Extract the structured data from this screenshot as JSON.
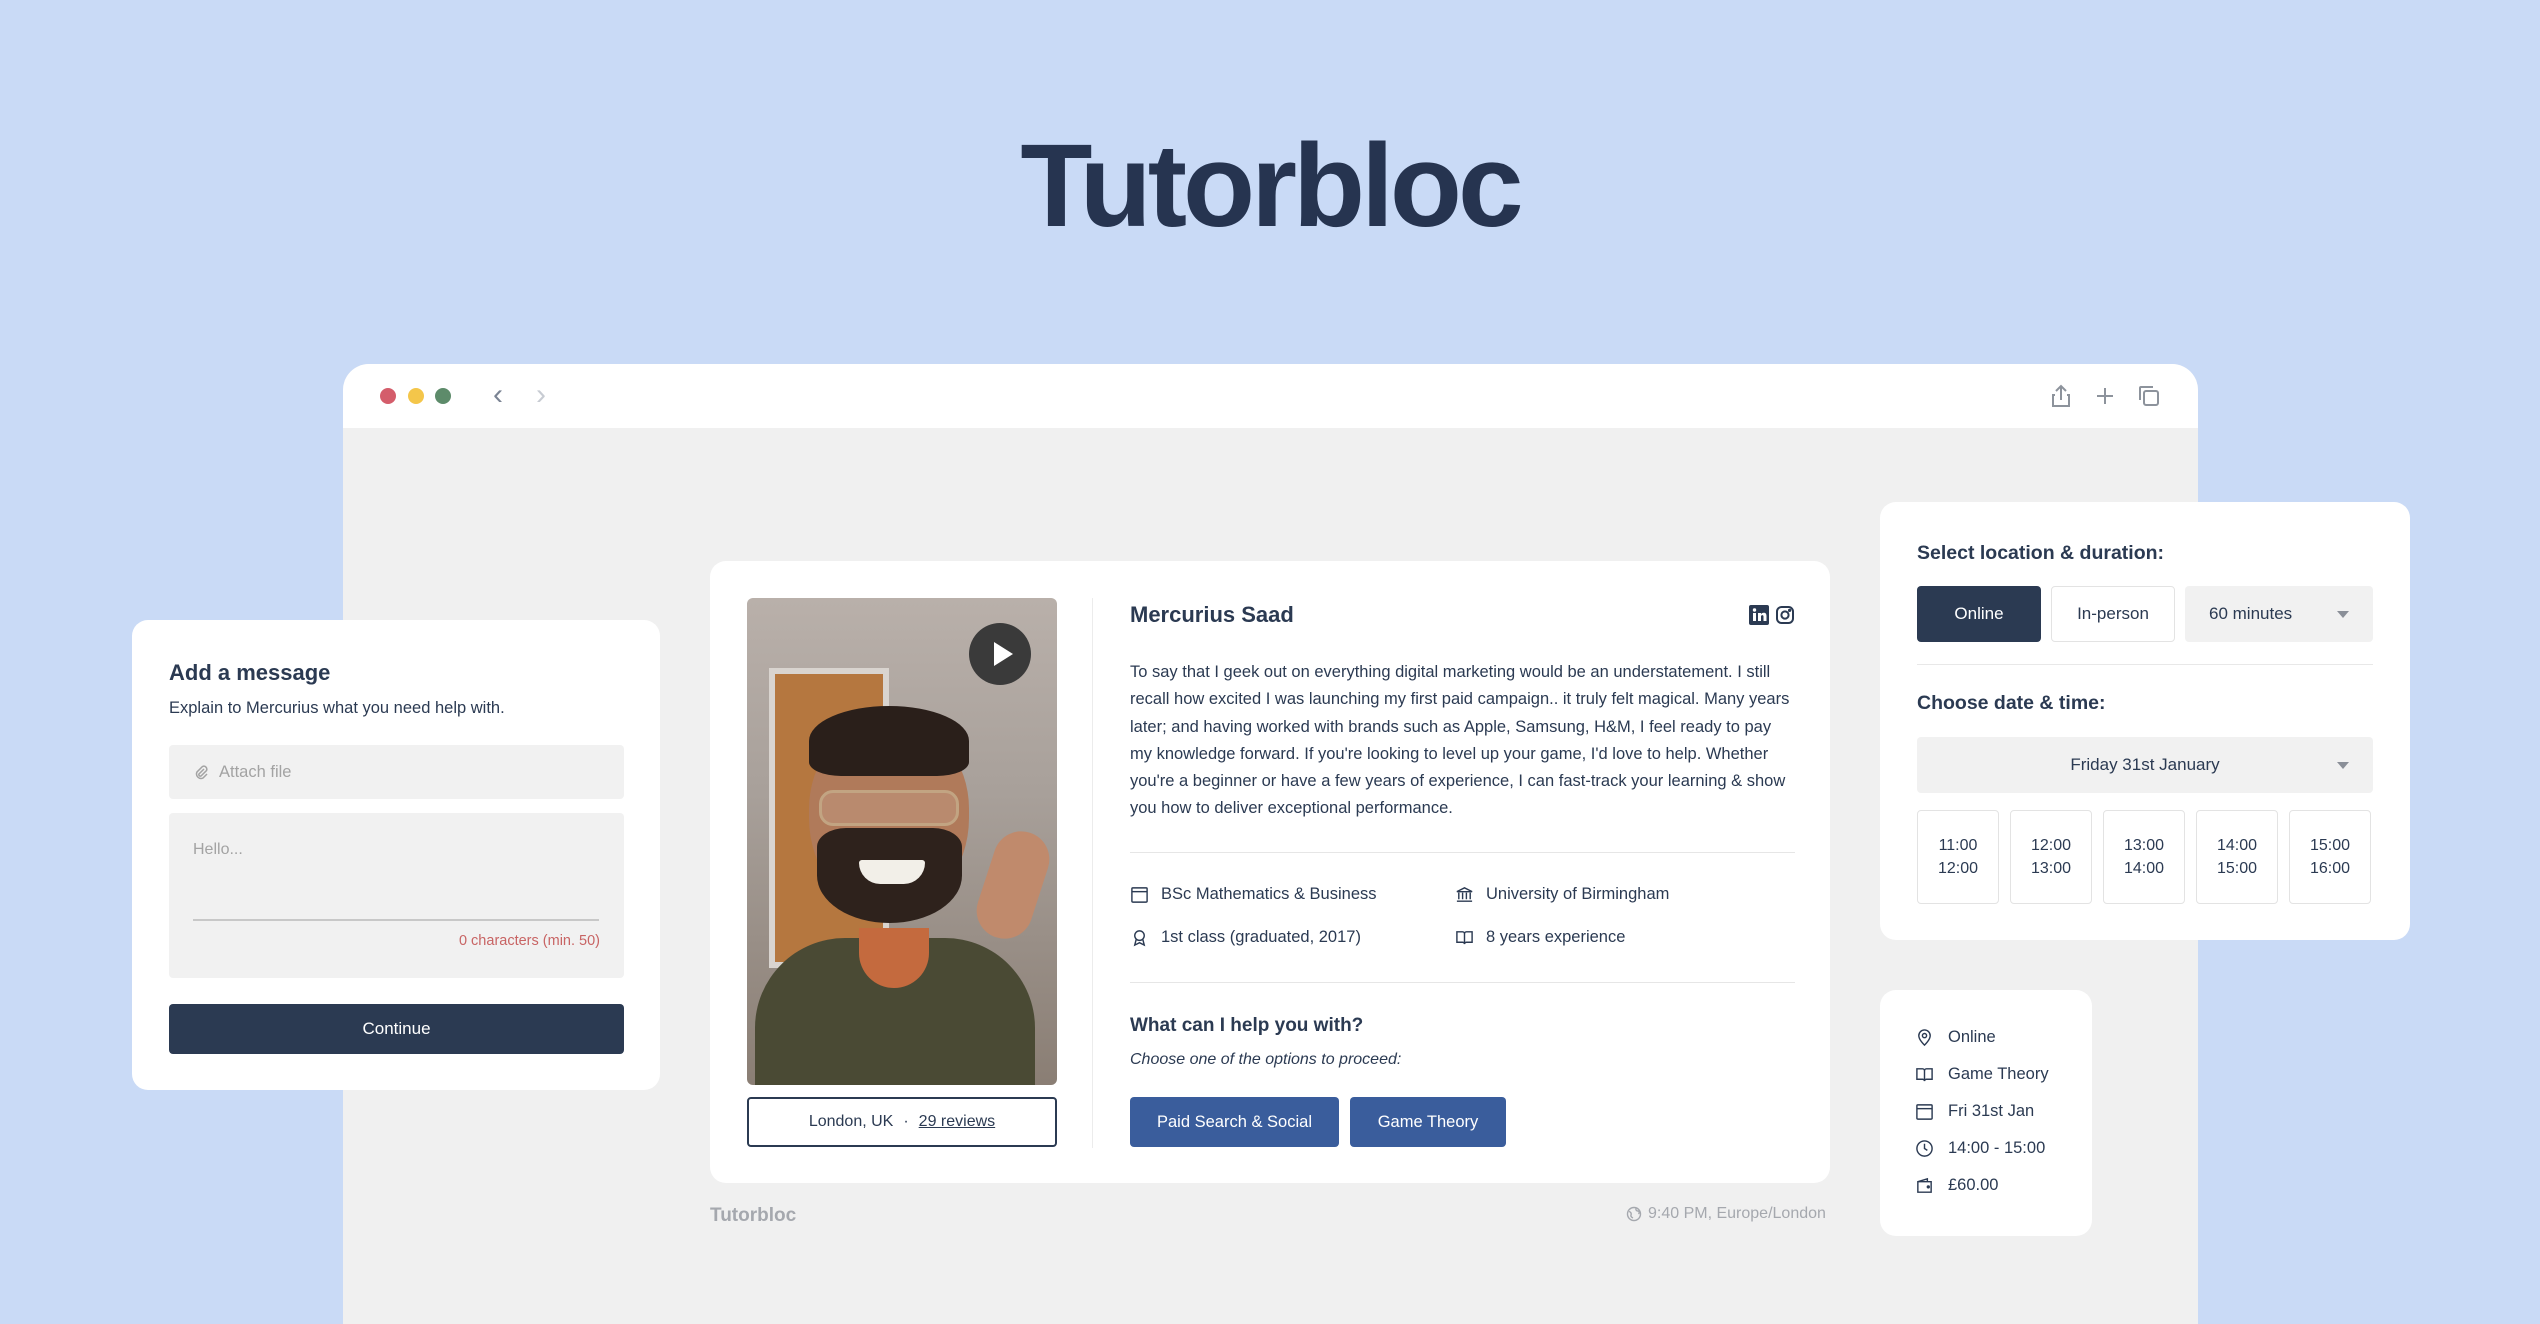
{
  "brand": {
    "title": "Tutorbloc"
  },
  "browser": {
    "back": "‹",
    "forward": "›"
  },
  "tutor": {
    "name": "Mercurius Saad",
    "bio": "To say that I geek out on everything digital marketing would be an understatement. I still recall how excited I was launching my first paid campaign.. it truly felt magical. Many years later; and having worked with brands such as Apple, Samsung, H&M, I feel ready to pay my knowledge forward. If you're looking to level up your game, I'd love to help. Whether you're a beginner or have a few years of experience, I can fast-track your learning & show you how to deliver exceptional performance.",
    "location": "London, UK",
    "separator": "·",
    "reviews": "29 reviews",
    "credentials": {
      "degree": "BSc Mathematics & Business",
      "university": "University of Birmingham",
      "grade": "1st class (graduated, 2017)",
      "experience": "8 years experience"
    },
    "help_title": "What can I help you with?",
    "help_subtitle": "Choose one of the options to proceed:",
    "options": [
      "Paid Search & Social",
      "Game Theory"
    ]
  },
  "footer": {
    "brand": "Tutorbloc",
    "time": "9:40 PM, Europe/London"
  },
  "message": {
    "title": "Add a message",
    "subtitle": "Explain to Mercurius what you need help with.",
    "attach_label": "Attach file",
    "textarea_placeholder": "Hello...",
    "char_count": "0 characters (min. 50)",
    "continue_label": "Continue"
  },
  "booking": {
    "location_heading": "Select location & duration:",
    "online": "Online",
    "in_person": "In-person",
    "duration": "60 minutes",
    "date_heading": "Choose date & time:",
    "date": "Friday 31st January",
    "slots": [
      {
        "start": "11:00",
        "end": "12:00"
      },
      {
        "start": "12:00",
        "end": "13:00"
      },
      {
        "start": "13:00",
        "end": "14:00"
      },
      {
        "start": "14:00",
        "end": "15:00"
      },
      {
        "start": "15:00",
        "end": "16:00"
      }
    ]
  },
  "summary": {
    "location": "Online",
    "subject": "Game Theory",
    "date": "Fri 31st Jan",
    "time": "14:00 - 15:00",
    "price": "£60.00"
  },
  "colors": {
    "background": "#c9daf6",
    "navy": "#2b3a52",
    "accent_blue": "#3a5d9c",
    "error_red": "#c86464"
  }
}
